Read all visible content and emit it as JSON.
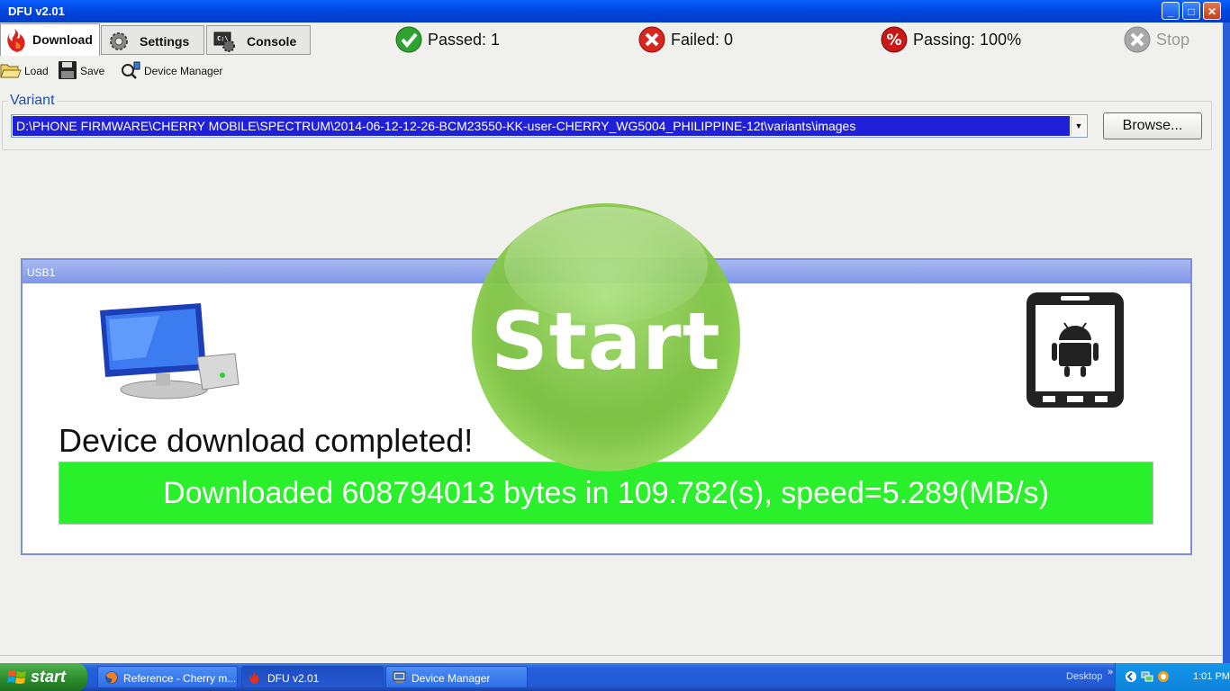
{
  "window": {
    "title": "DFU v2.01"
  },
  "tabs": [
    {
      "label": "Download",
      "active": true,
      "icon": "flame-icon"
    },
    {
      "label": "Settings",
      "active": false,
      "icon": "gear-icon"
    },
    {
      "label": "Console",
      "active": false,
      "icon": "console-icon"
    }
  ],
  "status": {
    "passed": "Passed: 1",
    "failed": "Failed: 0",
    "passing": "Passing: 100%",
    "stop": "Stop"
  },
  "toolbar": {
    "load": "Load",
    "save": "Save",
    "device_manager": "Device Manager"
  },
  "variant": {
    "legend": "Variant",
    "path": "D:\\PHONE FIRMWARE\\CHERRY MOBILE\\SPECTRUM\\2014-06-12-12-26-BCM23550-KK-user-CHERRY_WG5004_PHILIPPINE-12t\\variants\\images",
    "browse": "Browse..."
  },
  "usb": {
    "title": "USB1",
    "message": "Device download completed!",
    "speed": "Downloaded 608794013 bytes in 109.782(s), speed=5.289(MB/s)"
  },
  "start_button": {
    "label": "Start"
  },
  "taskbar": {
    "start": "start",
    "items": [
      {
        "label": "Reference - Cherry m...",
        "icon": "firefox-icon",
        "active": false
      },
      {
        "label": "DFU v2.01",
        "icon": "flame-icon",
        "active": true
      },
      {
        "label": "Device Manager",
        "icon": "computer-icon",
        "active": false
      }
    ],
    "desktop": "Desktop",
    "clock": "1:01 PM"
  },
  "colors": {
    "title_bar": "#0048e0",
    "selection": "#2020d8",
    "speed_bar": "#29f02a",
    "start_orb": "#78be3c",
    "passed_green": "#2fa32f",
    "failed_red": "#d8261f"
  }
}
